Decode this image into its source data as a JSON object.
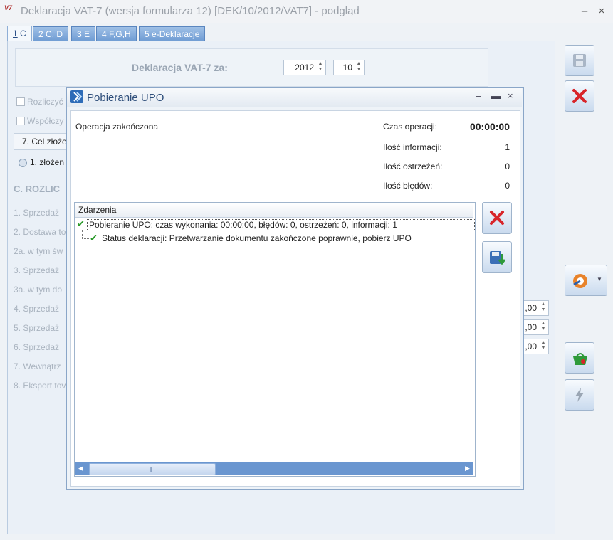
{
  "window": {
    "title": "Deklaracja VAT-7 (wersja formularza 12) [DEK/10/2012/VAT7] - podgląd",
    "logo": "V7"
  },
  "tabs": [
    {
      "key": "1",
      "label": " C"
    },
    {
      "key": "2",
      "label": " C, D"
    },
    {
      "key": "3",
      "label": " E"
    },
    {
      "key": "4",
      "label": " F,G,H"
    },
    {
      "key": "5",
      "label": " e-Deklaracje"
    }
  ],
  "header": {
    "label": "Deklaracja VAT-7 za:",
    "year": "2012",
    "month": "10"
  },
  "background_form": {
    "checkbox_1": "Rozliczyć",
    "checkbox_2": "Współczy",
    "section_7": "7. Cel złoże",
    "radio_1": "1. złożen",
    "section_c": "C. ROZLIC",
    "rows": [
      "1. Sprzedaż",
      "2. Dostawa to",
      "2a. w tym św",
      "3. Sprzedaż",
      "3a. w tym do",
      "4. Sprzedaż",
      "5. Sprzedaż",
      "6. Sprzedaż",
      "7. Wewnątrz",
      "8. Eksport tov"
    ],
    "values": [
      ",00",
      ",00",
      ",00"
    ]
  },
  "dialog": {
    "title": "Pobieranie UPO",
    "status": "Operacja zakończona",
    "time_label": "Czas operacji:",
    "time_value": "00:00:00",
    "info_label": "Ilość informacji:",
    "info_value": "1",
    "warn_label": "Ilość ostrzeżeń:",
    "warn_value": "0",
    "err_label": "Ilość błędów:",
    "err_value": "0",
    "events_header": "Zdarzenia",
    "events": [
      "Pobieranie UPO: czas wykonania: 00:00:00, błędów: 0, ostrzeżeń: 0, informacji: 1",
      "Status deklaracji: Przetwarzanie dokumentu zakończone poprawnie, pobierz UPO"
    ]
  },
  "colors": {
    "accent": "#6a96d0",
    "close_red": "#d8252a",
    "check_green": "#2a9a2a"
  }
}
